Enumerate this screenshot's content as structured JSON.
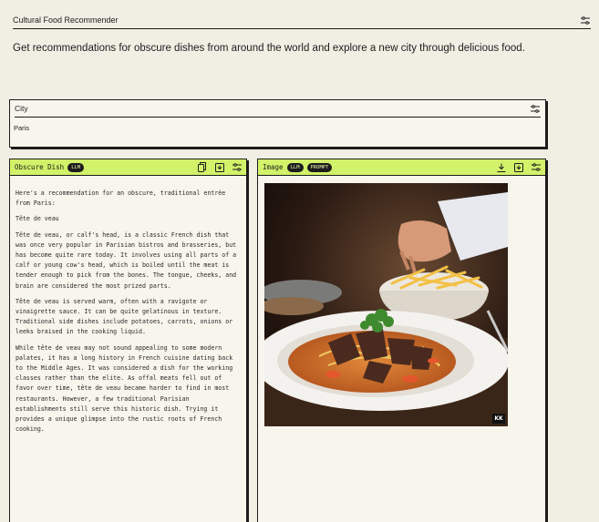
{
  "app": {
    "title": "Cultural Food Recommender",
    "tagline": "Get recommendations for obscure dishes from around the world and explore a new city through delicious food."
  },
  "city": {
    "label": "City",
    "value": "Paris"
  },
  "dish_panel": {
    "title": "Obscure Dish",
    "badge": "LLM",
    "paragraphs": [
      "Here's a recommendation for an obscure, traditional entrée from Paris:",
      "Tête de veau",
      "Tête de veau, or calf's head, is a classic French dish that was once very popular in Parisian bistros and brasseries, but has become quite rare today. It involves using all parts of a calf or young cow's head, which is boiled until the meat is tender enough to pick from the bones. The tongue, cheeks, and brain are considered the most prized parts.",
      "Tête de veau is served warm, often with a ravigote or vinaigrette sauce. It can be quite gelatinous in texture. Traditional side dishes include potatoes, carrots, onions or leeks braised in the cooking liquid.",
      "While tête de veau may not sound appealing to some modern palates, it has a long history in French cuisine dating back to the Middle Ages. It was considered a dish for the working classes rather than the elite. As offal meats fell out of favor over time, tête de veau became harder to find in most restaurants. However, a few traditional Parisian establishments still serve this historic dish. Trying it provides a unique glimpse into the rustic roots of French cooking."
    ]
  },
  "image_panel": {
    "title": "Image",
    "badges": [
      "LLM",
      "PROMPT"
    ],
    "watermark": "KK"
  },
  "colors": {
    "background": "#f1efe4",
    "accent": "#d2f26a",
    "ink": "#1c1c1c"
  },
  "icons": {
    "header": "tune-icon",
    "dish_panel": [
      "copy-icon",
      "save-icon",
      "tune-icon"
    ],
    "image_panel": [
      "download-icon",
      "save-icon",
      "tune-icon"
    ]
  }
}
